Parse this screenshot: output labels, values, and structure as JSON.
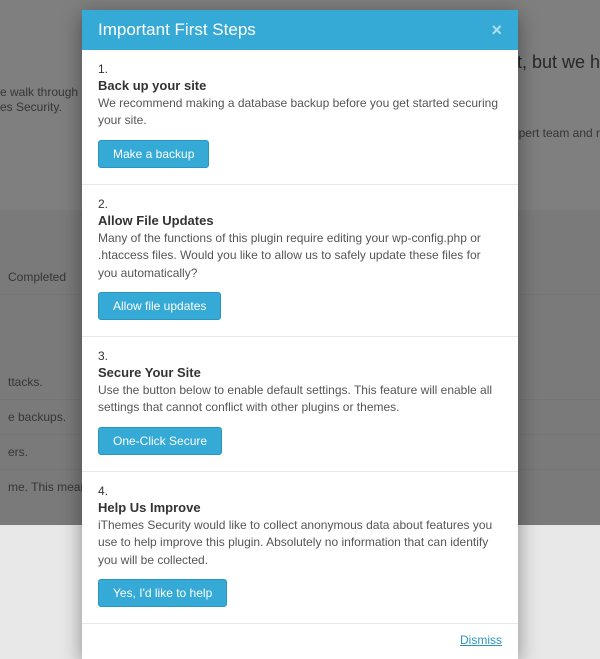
{
  "bg": {
    "heading_fragment": "tt, but we h",
    "line1": "e walk through h",
    "line2": "es Security.",
    "line3": "xpert team and r",
    "completed": "Completed",
    "row1": "ttacks.",
    "row2": "e backups.",
    "row3": "ers.",
    "row4": "me. This means t"
  },
  "modal": {
    "title": "Important First Steps",
    "close": "×",
    "dismiss": "Dismiss",
    "steps": [
      {
        "num": "1.",
        "title": "Back up your site",
        "desc": "We recommend making a database backup before you get started securing your site.",
        "button": "Make a backup"
      },
      {
        "num": "2.",
        "title": "Allow File Updates",
        "desc": "Many of the functions of this plugin require editing your wp-config.php or .htaccess files. Would you like to allow us to safely update these files for you automatically?",
        "button": "Allow file updates"
      },
      {
        "num": "3.",
        "title": "Secure Your Site",
        "desc": "Use the button below to enable default settings. This feature will enable all settings that cannot conflict with other plugins or themes.",
        "button": "One-Click Secure"
      },
      {
        "num": "4.",
        "title": "Help Us Improve",
        "desc": "iThemes Security would like to collect anonymous data about features you use to help improve this plugin. Absolutely no information that can identify you will be collected.",
        "button": "Yes, I'd like to help"
      }
    ]
  }
}
